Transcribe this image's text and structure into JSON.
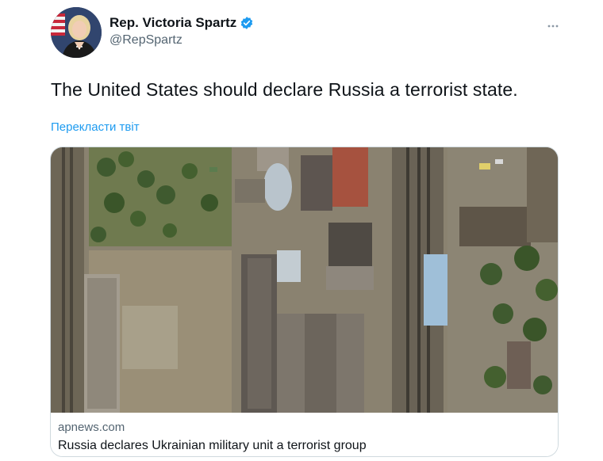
{
  "author": {
    "name": "Rep. Victoria Spartz",
    "handle": "@RepSpartz",
    "verified": true
  },
  "more_icon": "ellipsis-icon",
  "tweet": {
    "text": "The United States should declare Russia a terrorist state.",
    "translate_label": "Перекласти твіт"
  },
  "link_card": {
    "domain": "apnews.com",
    "title": "Russia declares Ukrainian military unit a terrorist group",
    "image": "satellite-image"
  },
  "colors": {
    "link_blue": "#1d9bf0",
    "secondary_text": "#536471",
    "primary_text": "#0f1419",
    "card_border": "#cfd9de"
  }
}
